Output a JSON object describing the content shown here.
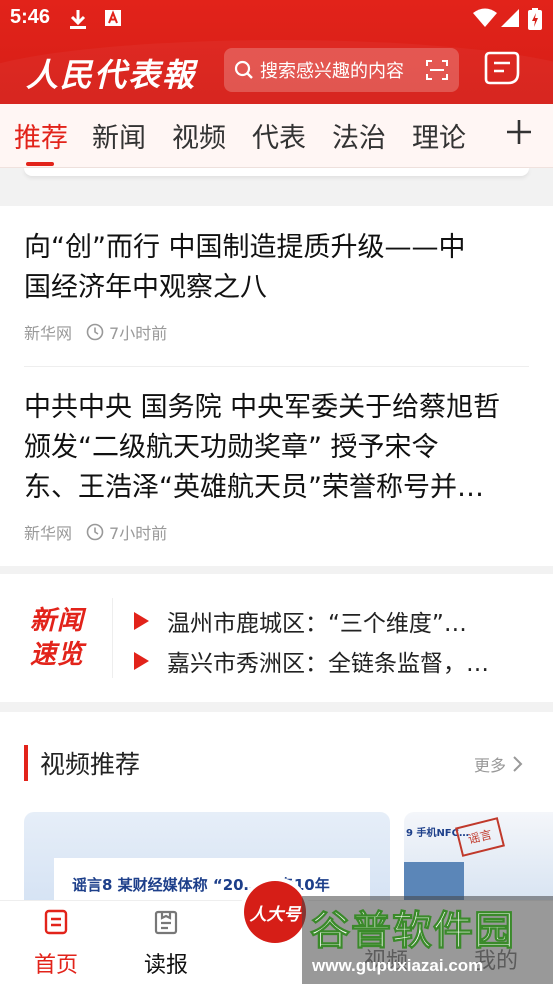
{
  "status_bar": {
    "time": "5:46"
  },
  "header": {
    "logo_text": "人民代表報",
    "search_placeholder": "搜索感兴趣的内容"
  },
  "tabs": [
    {
      "label": "推荐",
      "active": true
    },
    {
      "label": "新闻",
      "active": false
    },
    {
      "label": "视频",
      "active": false
    },
    {
      "label": "代表",
      "active": false
    },
    {
      "label": "法治",
      "active": false
    },
    {
      "label": "理论",
      "active": false
    }
  ],
  "articles": [
    {
      "title_lines": [
        "向“创”而行 中国制造提质升级——中",
        "国经济年中观察之八"
      ],
      "source": "新华网",
      "time": "7小时前"
    },
    {
      "title_lines": [
        "中共中央 国务院 中央军委关于给蔡旭哲",
        "颁发“二级航天功勋奖章” 授予宋令",
        "东、王浩泽“英雄航天员”荣誉称号并…"
      ],
      "source": "新华网",
      "time": "7小时前"
    }
  ],
  "news_flash": {
    "logo_line1": "新闻",
    "logo_line2": "速览",
    "items": [
      "温州市鹿城区：“三个维度”…",
      "嘉兴市秀洲区：全链条监督，…"
    ]
  },
  "video_section": {
    "title": "视频推荐",
    "more": "更多",
    "card1_label": "谣言8  某财经媒体称 “20… …专10年",
    "card2_label": "9  手机NFC…",
    "card2_stamp": "谣言"
  },
  "bottom_nav": {
    "home": "首页",
    "read": "读报",
    "center": "人大号",
    "video": "视频",
    "mine": "我的"
  },
  "watermark": {
    "title": "谷普软件园",
    "url": "www.gupuxiazai.com"
  },
  "colors": {
    "brand_red": "#e2231a",
    "text_dark": "#111111",
    "text_meta": "#999999"
  }
}
